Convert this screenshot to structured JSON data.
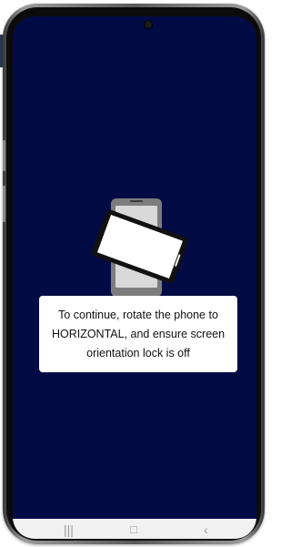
{
  "colors": {
    "screen_background": "#030b45",
    "card_background": "#ffffff",
    "text": "#111111",
    "nav_bar": "#f1f1f1"
  },
  "rotate_prompt": {
    "illustration": "phone-rotate-icon",
    "message": "To continue, rotate the phone to HORIZONTAL, and ensure screen orientation lock is off"
  },
  "nav_bar": {
    "icons": [
      "recent-apps-icon",
      "home-icon",
      "back-icon"
    ]
  }
}
